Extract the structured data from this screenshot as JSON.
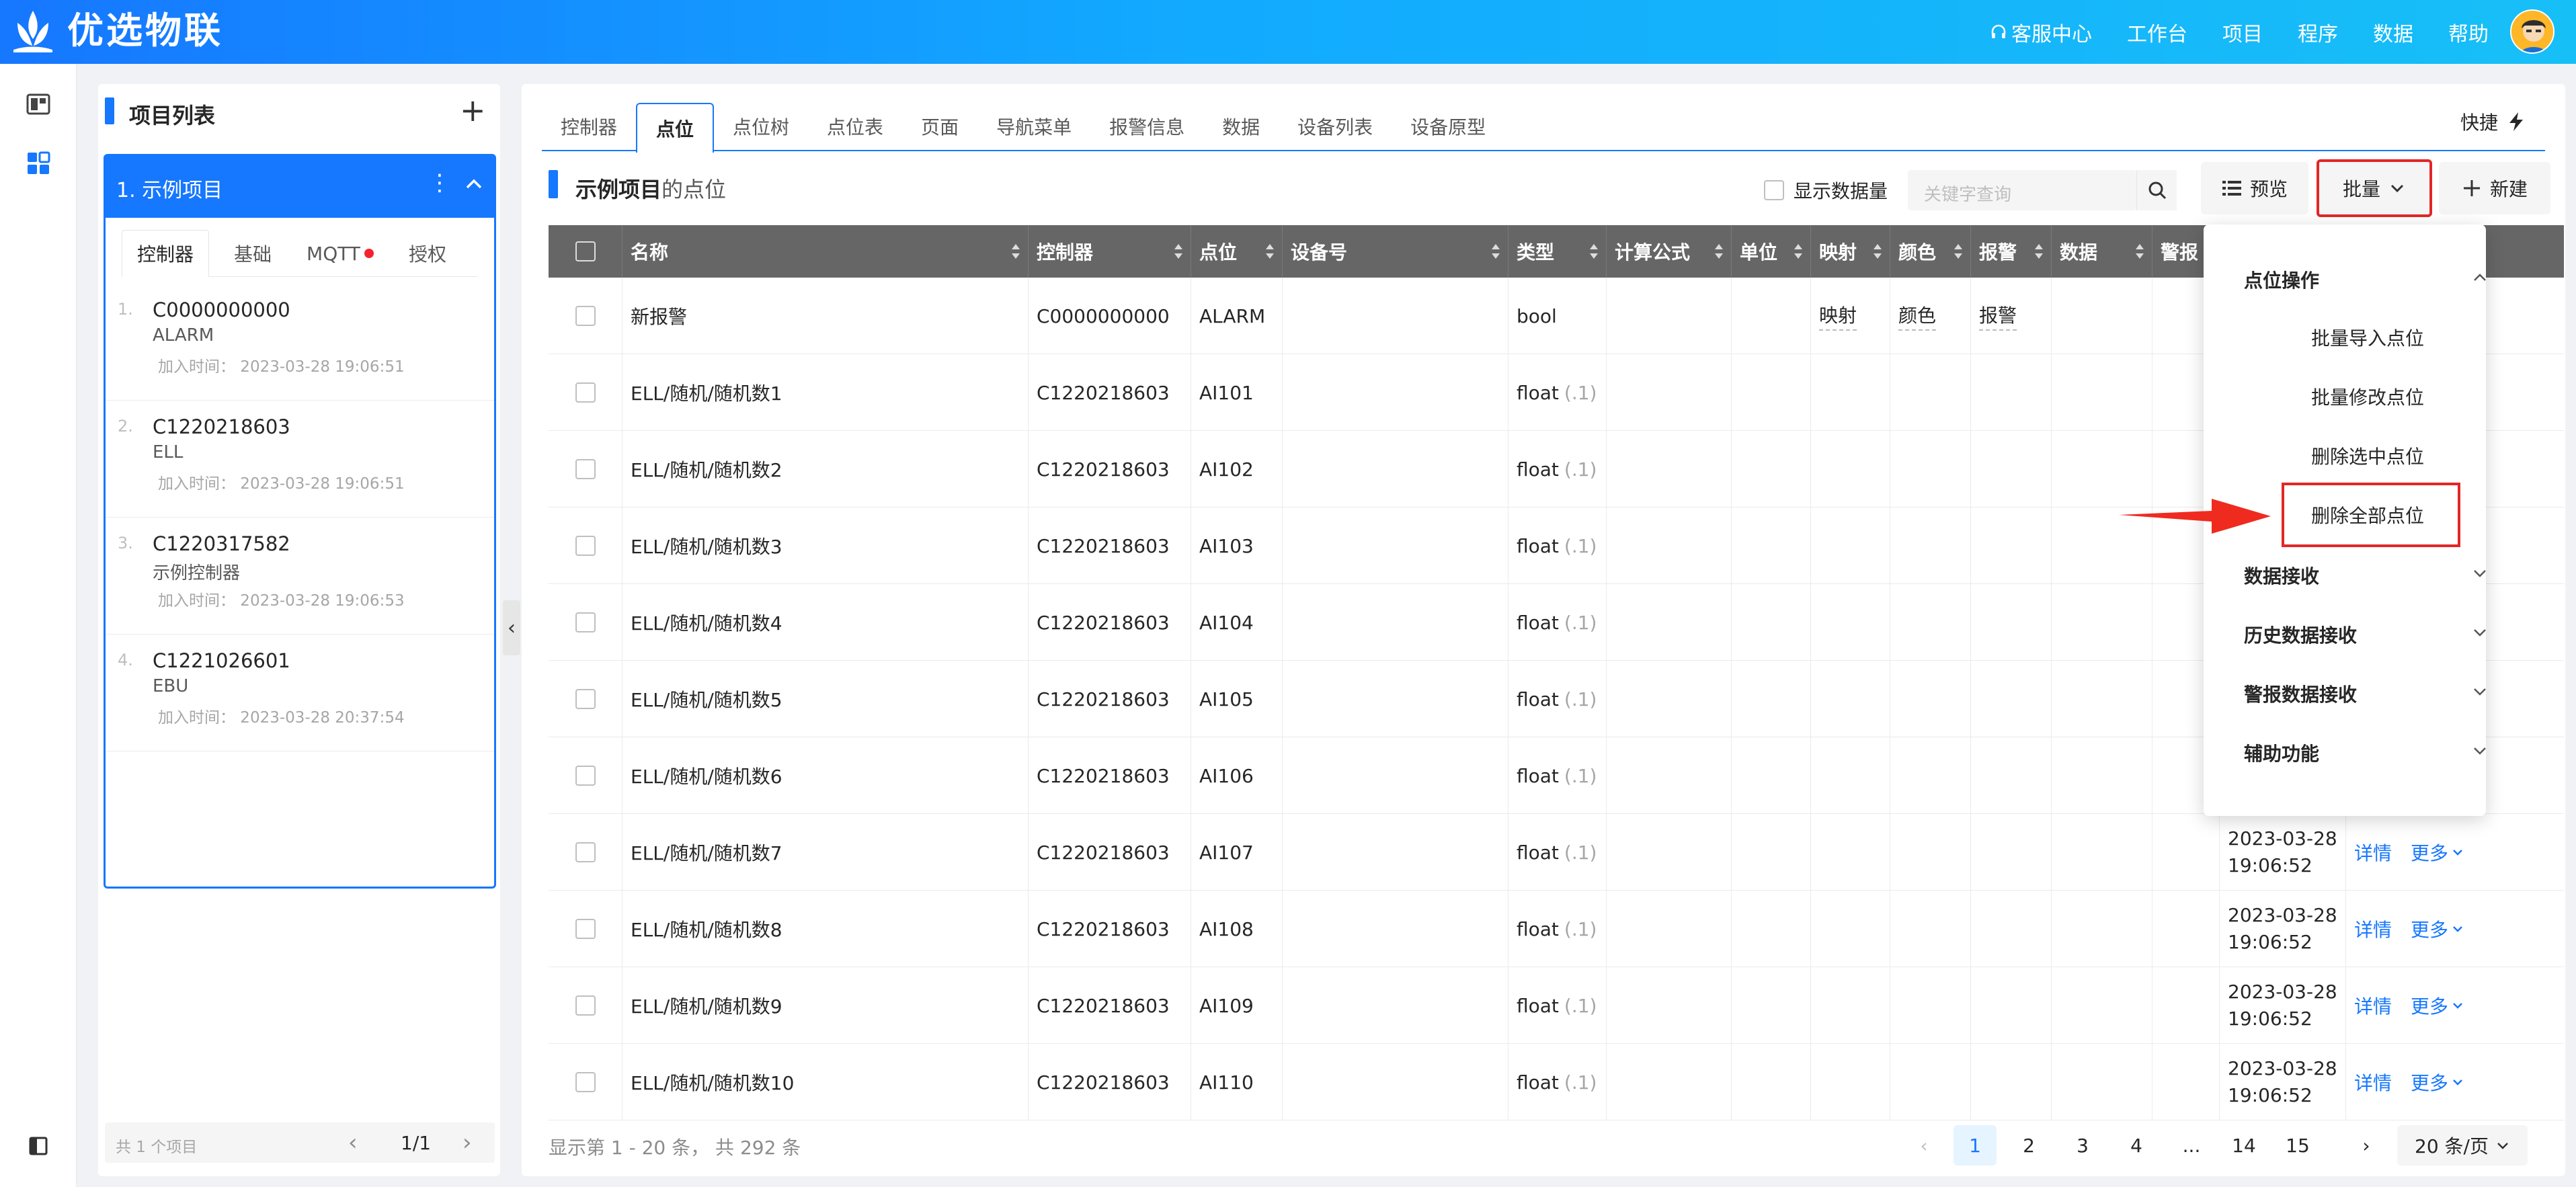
{
  "brand": "优选物联",
  "topnav": [
    {
      "label": "客服中心",
      "icon": "headset-icon"
    },
    {
      "label": "工作台"
    },
    {
      "label": "项目"
    },
    {
      "label": "程序"
    },
    {
      "label": "数据"
    },
    {
      "label": "帮助"
    }
  ],
  "project_panel": {
    "title": "项目列表",
    "project_name": "1. 示例项目",
    "subtabs": [
      "控制器",
      "基础",
      "MQTT",
      "授权"
    ],
    "controllers": [
      {
        "index": "1.",
        "code": "C0000000000",
        "name": "ALARM",
        "time": "加入时间： 2023-03-28 19:06:51"
      },
      {
        "index": "2.",
        "code": "C1220218603",
        "name": "ELL",
        "time": "加入时间： 2023-03-28 19:06:51"
      },
      {
        "index": "3.",
        "code": "C1220317582",
        "name": "示例控制器",
        "time": "加入时间： 2023-03-28 19:06:53"
      },
      {
        "index": "4.",
        "code": "C1221026601",
        "name": "EBU",
        "time": "加入时间： 2023-03-28 20:37:54"
      }
    ],
    "footer_count": "共 1 个项目",
    "footer_page": "1/1"
  },
  "tabs": [
    "控制器",
    "点位",
    "点位树",
    "点位表",
    "页面",
    "导航菜单",
    "报警信息",
    "数据",
    "设备列表",
    "设备原型"
  ],
  "quick_label": "快捷",
  "section": {
    "title_bold": "示例项目",
    "title_rest": "的点位"
  },
  "toolbar": {
    "show_volume": "显示数据量",
    "search_placeholder": "关键字查询",
    "preview": "预览",
    "batch": "批量",
    "new": "新建"
  },
  "table": {
    "headers": [
      "名称",
      "控制器",
      "点位",
      "设备号",
      "类型",
      "计算公式",
      "单位",
      "映射",
      "颜色",
      "报警",
      "数据",
      "警报"
    ],
    "rows": [
      {
        "name": "新报警",
        "controller": "C0000000000",
        "point": "ALARM",
        "type": "bool",
        "fmt": "",
        "map": "映射",
        "color": "颜色",
        "alarm": "报警",
        "date1": "",
        "date2": "",
        "actions": false
      },
      {
        "name": "ELL/随机/随机数1",
        "controller": "C1220218603",
        "point": "AI101",
        "type": "float",
        "fmt": "(.1)",
        "map": "",
        "color": "",
        "alarm": "",
        "date1": "",
        "date2": "",
        "actions": false
      },
      {
        "name": "ELL/随机/随机数2",
        "controller": "C1220218603",
        "point": "AI102",
        "type": "float",
        "fmt": "(.1)",
        "map": "",
        "color": "",
        "alarm": "",
        "date1": "",
        "date2": "",
        "actions": false
      },
      {
        "name": "ELL/随机/随机数3",
        "controller": "C1220218603",
        "point": "AI103",
        "type": "float",
        "fmt": "(.1)",
        "map": "",
        "color": "",
        "alarm": "",
        "date1": "",
        "date2": "",
        "actions": false
      },
      {
        "name": "ELL/随机/随机数4",
        "controller": "C1220218603",
        "point": "AI104",
        "type": "float",
        "fmt": "(.1)",
        "map": "",
        "color": "",
        "alarm": "",
        "date1": "",
        "date2": "",
        "actions": false
      },
      {
        "name": "ELL/随机/随机数5",
        "controller": "C1220218603",
        "point": "AI105",
        "type": "float",
        "fmt": "(.1)",
        "map": "",
        "color": "",
        "alarm": "",
        "date1": "",
        "date2": "",
        "actions": false
      },
      {
        "name": "ELL/随机/随机数6",
        "controller": "C1220218603",
        "point": "AI106",
        "type": "float",
        "fmt": "(.1)",
        "map": "",
        "color": "",
        "alarm": "",
        "date1": "",
        "date2": "",
        "actions": false
      },
      {
        "name": "ELL/随机/随机数7",
        "controller": "C1220218603",
        "point": "AI107",
        "type": "float",
        "fmt": "(.1)",
        "map": "",
        "color": "",
        "alarm": "",
        "date1": "2023-03-28",
        "date2": "19:06:52",
        "actions": true
      },
      {
        "name": "ELL/随机/随机数8",
        "controller": "C1220218603",
        "point": "AI108",
        "type": "float",
        "fmt": "(.1)",
        "map": "",
        "color": "",
        "alarm": "",
        "date1": "2023-03-28",
        "date2": "19:06:52",
        "actions": true
      },
      {
        "name": "ELL/随机/随机数9",
        "controller": "C1220218603",
        "point": "AI109",
        "type": "float",
        "fmt": "(.1)",
        "map": "",
        "color": "",
        "alarm": "",
        "date1": "2023-03-28",
        "date2": "19:06:52",
        "actions": true
      },
      {
        "name": "ELL/随机/随机数10",
        "controller": "C1220218603",
        "point": "AI110",
        "type": "float",
        "fmt": "(.1)",
        "map": "",
        "color": "",
        "alarm": "",
        "date1": "2023-03-28",
        "date2": "19:06:52",
        "actions": true
      }
    ],
    "detail_label": "详情",
    "more_label": "更多"
  },
  "dropdown": {
    "groups": [
      {
        "label": "点位操作",
        "expanded": true,
        "items": [
          "批量导入点位",
          "批量修改点位",
          "删除选中点位",
          "删除全部点位"
        ]
      },
      {
        "label": "数据接收",
        "expanded": false
      },
      {
        "label": "历史数据接收",
        "expanded": false
      },
      {
        "label": "警报数据接收",
        "expanded": false
      },
      {
        "label": "辅助功能",
        "expanded": false
      }
    ]
  },
  "pagination": {
    "info": "显示第 1 - 20 条， 共 292 条",
    "pages": [
      "1",
      "2",
      "3",
      "4",
      "...",
      "14",
      "15"
    ],
    "current": "1",
    "page_size": "20 条/页"
  },
  "colors": {
    "primary": "#1677ff",
    "highlight": "#e32626",
    "header_bg": "#666666"
  }
}
